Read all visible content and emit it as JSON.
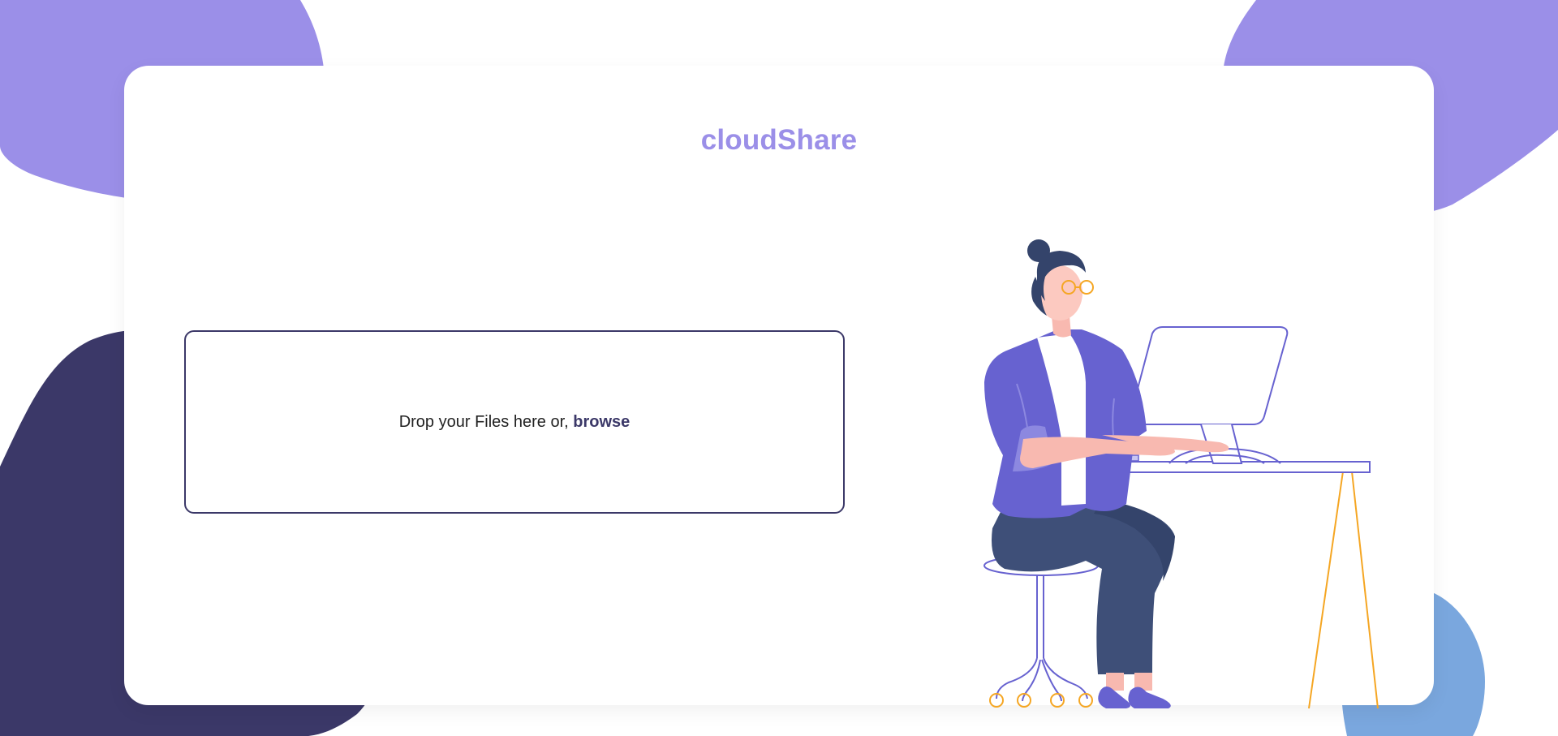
{
  "app": {
    "brand": "cloudShare"
  },
  "upload": {
    "prompt": "Drop your Files here or,",
    "browse_label": "browse"
  },
  "theme": {
    "accent": "#9b8fe8",
    "dark": "#3b3868",
    "blue": "#7aa7de",
    "illustration_purple": "#6762d0",
    "illustration_yellow": "#f5a623"
  },
  "icons": {
    "illustration": "person-at-computer-illustration"
  }
}
